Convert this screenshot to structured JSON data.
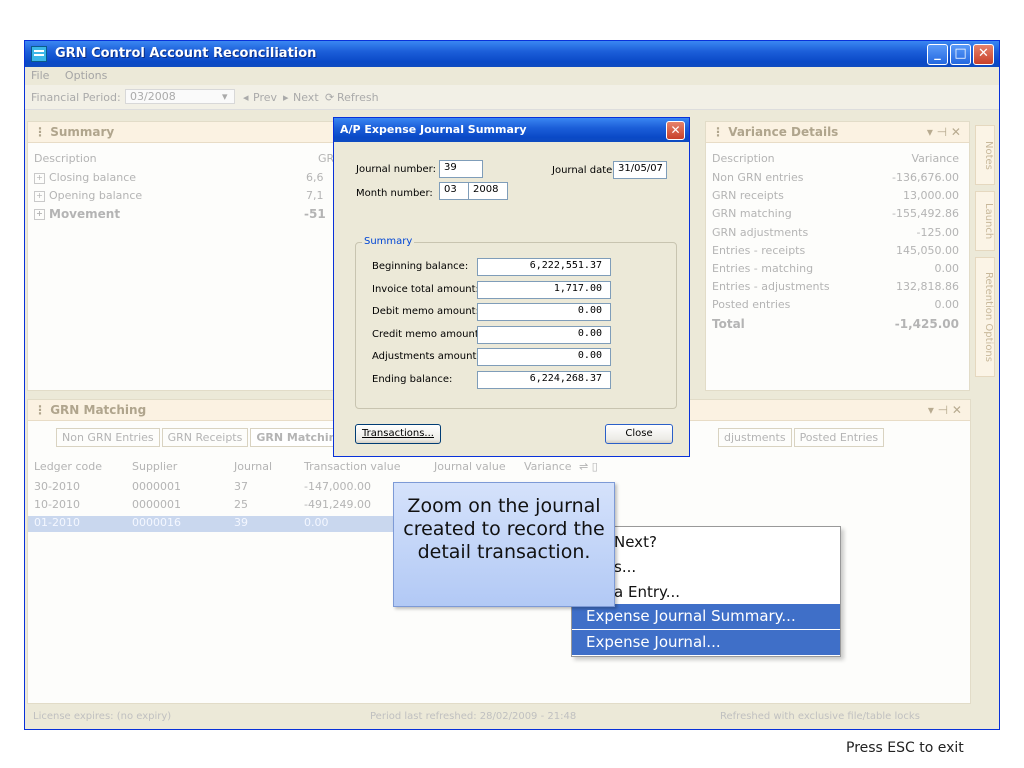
{
  "window": {
    "title": "GRN Control Account Reconciliation"
  },
  "menu": [
    "File",
    "Options"
  ],
  "toolbar": {
    "period_label": "Financial Period:",
    "period_value": "03/2008",
    "prev": "Prev",
    "next": "Next",
    "refresh": "Refresh"
  },
  "summary": {
    "title": "Summary",
    "col_desc": "Description",
    "col_grn": "GR",
    "rows": [
      {
        "label": "Closing balance",
        "value": "6,6"
      },
      {
        "label": "Opening balance",
        "value": "7,1"
      },
      {
        "label": "Movement",
        "value": "-51"
      }
    ]
  },
  "variance": {
    "title": "Variance Details",
    "col_desc": "Description",
    "col_var": "Variance",
    "rows": [
      {
        "label": "Non GRN entries",
        "value": "-136,676.00"
      },
      {
        "label": "GRN receipts",
        "value": "13,000.00"
      },
      {
        "label": "GRN matching",
        "value": "-155,492.86"
      },
      {
        "label": "GRN adjustments",
        "value": "-125.00"
      },
      {
        "label": "Entries - receipts",
        "value": "145,050.00"
      },
      {
        "label": "Entries - matching",
        "value": "0.00"
      },
      {
        "label": "Entries - adjustments",
        "value": "132,818.86"
      },
      {
        "label": "Posted entries",
        "value": "0.00"
      },
      {
        "label": "Total",
        "value": "-1,425.00"
      }
    ]
  },
  "side_tabs": [
    "Notes",
    "Launch",
    "Retention Options"
  ],
  "grn_matching": {
    "title": "GRN Matching",
    "tabs": [
      "Non GRN Entries",
      "GRN Receipts",
      "GRN Matching"
    ],
    "tabs_right": [
      "djustments",
      "Posted Entries"
    ],
    "columns": [
      "Ledger code",
      "Supplier",
      "Journal",
      "Transaction value",
      "Journal value",
      "Variance"
    ],
    "rows": [
      {
        "ledger": "30-2010",
        "supplier": "0000001",
        "journal": "37",
        "trans": "-147,000.00"
      },
      {
        "ledger": "10-2010",
        "supplier": "0000001",
        "journal": "25",
        "trans": "-491,249.00"
      },
      {
        "ledger": "01-2010",
        "supplier": "0000016",
        "journal": "39",
        "trans": "0.00"
      }
    ]
  },
  "status": {
    "license": "License expires: (no expiry)",
    "refreshed": "Period last refreshed: 28/02/2009 - 21:48",
    "locks": "Refreshed with exclusive file/table locks"
  },
  "dialog": {
    "title": "A/P Expense Journal Summary",
    "journal_number_label": "Journal number:",
    "journal_number": "39",
    "journal_date_label": "Journal date:",
    "journal_date": "31/05/07",
    "month_number_label": "Month number:",
    "month": "03",
    "year": "2008",
    "group_label": "Summary",
    "fields": [
      {
        "label": "Beginning balance:",
        "value": "6,222,551.37"
      },
      {
        "label": "Invoice total amount:",
        "value": "1,717.00"
      },
      {
        "label": "Debit memo amount:",
        "value": "0.00"
      },
      {
        "label": "Credit memo amount:",
        "value": "0.00"
      },
      {
        "label": "Adjustments amount:",
        "value": "0.00"
      },
      {
        "label": "Ending balance:",
        "value": "6,224,268.37"
      }
    ],
    "transactions_button": "Transactions...",
    "close_button": "Close"
  },
  "callout": {
    "text": "Zoom on the journal created to record the detail transaction."
  },
  "context_menu": {
    "items": [
      "Next?",
      "s...",
      "a Entry...",
      "Expense Journal  Summary...",
      "Expense Journal..."
    ]
  },
  "hint": "Press ESC to exit"
}
